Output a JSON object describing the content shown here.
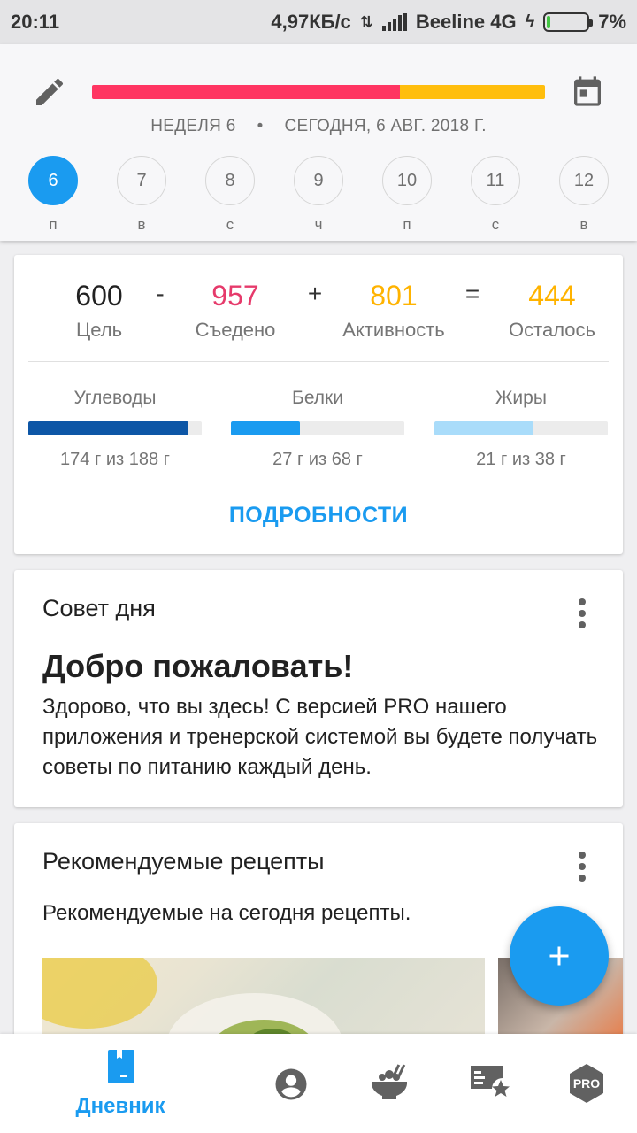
{
  "status_bar": {
    "time": "20:11",
    "speed": "4,97КБ/с",
    "carrier": "Beeline 4G",
    "battery": "7%",
    "battery_level": 0.07
  },
  "header": {
    "week": "НЕДЕЛЯ 6",
    "separator": "•",
    "today": "СЕГОДНЯ, 6 АВГ. 2018 Г.",
    "calorie_bar": {
      "eaten_fraction": 0.68,
      "eaten_color": "#ff3562",
      "remaining_color": "#ffbe0d"
    },
    "days": [
      {
        "num": "6",
        "letter": "п",
        "active": true
      },
      {
        "num": "7",
        "letter": "в",
        "active": false
      },
      {
        "num": "8",
        "letter": "с",
        "active": false
      },
      {
        "num": "9",
        "letter": "ч",
        "active": false
      },
      {
        "num": "10",
        "letter": "п",
        "active": false
      },
      {
        "num": "11",
        "letter": "с",
        "active": false
      },
      {
        "num": "12",
        "letter": "в",
        "active": false
      }
    ]
  },
  "summary": {
    "goal": {
      "value": "600",
      "label": "Цель"
    },
    "op1": "-",
    "eaten": {
      "value": "957",
      "label": "Съедено",
      "color": "#e63a6b"
    },
    "op2": "+",
    "activity": {
      "value": "801",
      "label": "Активность",
      "color": "#ffb300"
    },
    "op3": "=",
    "remaining": {
      "value": "444",
      "label": "Осталось",
      "color": "#ffb300"
    },
    "macros": [
      {
        "name": "Углеводы",
        "text": "174 г из 188 г",
        "fraction": 0.925,
        "color": "#0d56a6"
      },
      {
        "name": "Белки",
        "text": "27 г из 68 г",
        "fraction": 0.4,
        "color": "#1a9bf0"
      },
      {
        "name": "Жиры",
        "text": "21 г из 38 г",
        "fraction": 0.57,
        "color": "#a9dcfa"
      }
    ],
    "details_label": "ПОДРОБНОСТИ"
  },
  "tip_card": {
    "title": "Совет дня",
    "heading": "Добро пожаловать!",
    "body": "Здорово, что вы здесь! С версией PRO нашего приложения и тренерской системой вы будете получать советы по питанию каждый день."
  },
  "recipes_card": {
    "title": "Рекомендуемые рецепты",
    "subtitle": "Рекомендуемые на сегодня рецепты."
  },
  "bottom_nav": {
    "diary_label": "Дневник",
    "pro_label": "PRO",
    "active_color": "#1a9bf0",
    "icon_color": "#616161"
  }
}
